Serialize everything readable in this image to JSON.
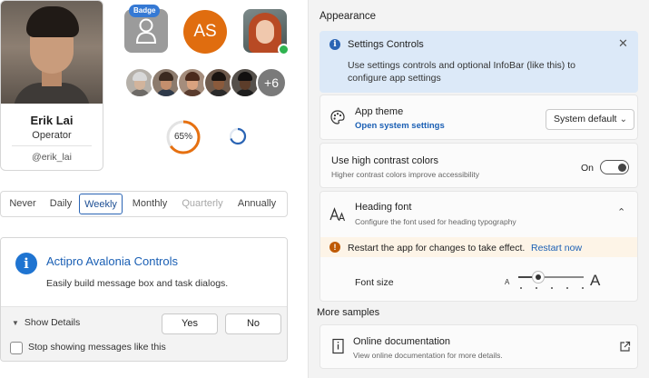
{
  "profile": {
    "name": "Erik Lai",
    "role": "Operator",
    "handle": "@erik_lai"
  },
  "avatars": {
    "badge_text": "Badge",
    "initials": "AS",
    "initials_color": "#e06d0f",
    "presence_color": "#2eb34f",
    "overflow_label": "+6"
  },
  "progress": {
    "ring_percent": 65,
    "ring_label": "65%",
    "ring_color": "#e67010"
  },
  "segmented": {
    "options": [
      "Never",
      "Daily",
      "Weekly",
      "Monthly",
      "Quarterly",
      "Annually"
    ],
    "selected": "Weekly",
    "disabled": "Quarterly"
  },
  "message_box": {
    "title": "Actipro Avalonia Controls",
    "body": "Easily build message box and task dialogs.",
    "show_details": "Show Details",
    "yes": "Yes",
    "no": "No",
    "checkbox_label": "Stop showing messages like this",
    "icon_letter": "i"
  },
  "settings": {
    "section_title": "Appearance",
    "infobar": {
      "title": "Settings Controls",
      "message": "Use settings controls and optional InfoBar (like this) to configure app settings",
      "close_glyph": "✕"
    },
    "theme": {
      "title": "App theme",
      "link": "Open system settings",
      "value": "System default"
    },
    "contrast": {
      "title": "Use high contrast colors",
      "description": "Higher contrast colors improve accessibility",
      "state_label": "On"
    },
    "heading_font": {
      "title": "Heading font",
      "description": "Configure the font used for heading typography",
      "restart_message": "Restart the app for changes to take effect.",
      "restart_link": "Restart now",
      "font_size_label": "Font size",
      "small_glyph": "A",
      "large_glyph": "A",
      "font_size_level": 0.3
    },
    "more_samples": "More samples",
    "docs": {
      "title": "Online documentation",
      "description": "View online documentation for more details."
    }
  },
  "colors": {
    "accent": "#1a5fb4",
    "infobar_bg": "#dce9f8",
    "warning_bg": "#fdf4e7",
    "warning_icon": "#bf5a05"
  }
}
